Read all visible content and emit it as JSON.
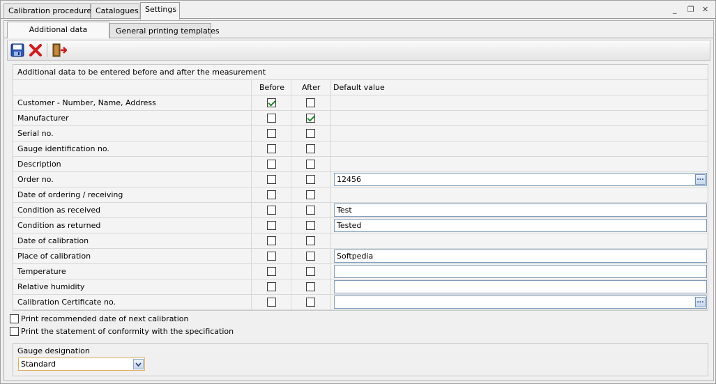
{
  "top_tabs": [
    "Calibration procedures",
    "Catalogues",
    "Settings"
  ],
  "window_controls": {
    "minimize": "_",
    "restore": "❐",
    "close": "✕"
  },
  "sub_tabs": [
    "Additional data",
    "General printing templates"
  ],
  "toolbar": {
    "save_icon": "save-icon",
    "delete_icon": "delete-icon",
    "exit_icon": "exit-icon"
  },
  "grid": {
    "title": "Additional data to be entered before and after the measurement",
    "headers": {
      "before": "Before",
      "after": "After",
      "default": "Default value"
    },
    "rows": [
      {
        "label": "Customer - Number, Name, Address",
        "before": true,
        "after": false
      },
      {
        "label": "Manufacturer",
        "before": false,
        "after": true
      },
      {
        "label": "Serial no.",
        "before": false,
        "after": false
      },
      {
        "label": "Gauge identification no.",
        "before": false,
        "after": false
      },
      {
        "label": "Description",
        "before": false,
        "after": false
      },
      {
        "label": "Order no.",
        "before": false,
        "after": false,
        "value": "12456",
        "has_input": true,
        "has_button": true
      },
      {
        "label": "Date of ordering / receiving",
        "before": false,
        "after": false
      },
      {
        "label": "Condition as received",
        "before": false,
        "after": false,
        "value": "Test",
        "has_input": true
      },
      {
        "label": "Condition as returned",
        "before": false,
        "after": false,
        "value": "Tested",
        "has_input": true
      },
      {
        "label": "Date of calibration",
        "before": false,
        "after": false
      },
      {
        "label": "Place of calibration",
        "before": false,
        "after": false,
        "value": "Softpedia",
        "has_input": true
      },
      {
        "label": "Temperature",
        "before": false,
        "after": false,
        "value": "",
        "has_input": true
      },
      {
        "label": "Relative humidity",
        "before": false,
        "after": false,
        "value": "",
        "has_input": true
      },
      {
        "label": "Calibration Certificate no.",
        "before": false,
        "after": false,
        "value": "",
        "has_input": true,
        "has_button": true
      }
    ]
  },
  "options": [
    {
      "label": "Print recommended date of next calibration",
      "checked": false
    },
    {
      "label": "Print the statement of conformity with the specification",
      "checked": false
    }
  ],
  "gauge": {
    "label": "Gauge designation",
    "selected": "Standard"
  },
  "browse_button_label": "..."
}
